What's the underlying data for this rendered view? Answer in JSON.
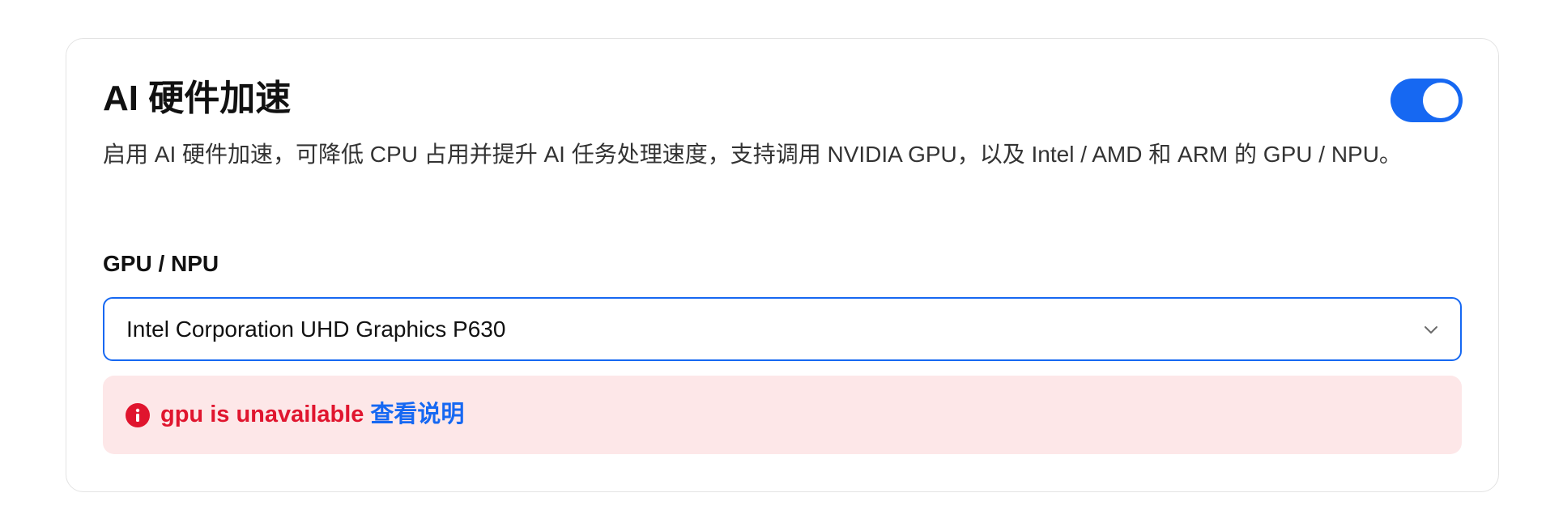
{
  "section": {
    "title": "AI 硬件加速",
    "toggle_on": true,
    "description": "启用 AI 硬件加速，可降低 CPU 占用并提升 AI 任务处理速度，支持调用 NVIDIA GPU，以及 Intel / AMD 和 ARM 的 GPU / NPU。"
  },
  "device_select": {
    "label": "GPU / NPU",
    "value": "Intel Corporation UHD Graphics P630"
  },
  "alert": {
    "message": "gpu is unavailable",
    "link_text": "查看说明"
  },
  "colors": {
    "accent": "#1668f2",
    "error": "#e0152e",
    "error_bg": "#fde7e8"
  },
  "icons": {
    "dropdown": "chevron-down-icon",
    "alert": "info-icon"
  }
}
